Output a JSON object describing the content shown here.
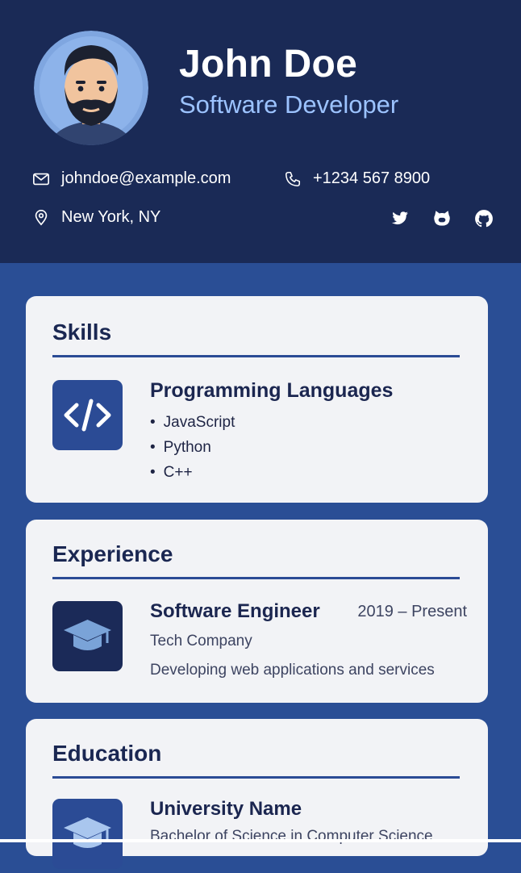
{
  "profile": {
    "name": "John Doe",
    "title": "Software Developer",
    "email": "johndoe@example.com",
    "phone": "+1234 567 8900",
    "location": "New York, NY",
    "social_icons": [
      "twitter-icon",
      "github-cat-icon",
      "github-icon"
    ]
  },
  "skills": {
    "heading": "Skills",
    "icon": "code-icon",
    "group_title": "Programming Languages",
    "items": [
      "JavaScript",
      "Python",
      "C++"
    ]
  },
  "experience": {
    "heading": "Experience",
    "icon": "graduation-cap-icon",
    "role": "Software Engineer",
    "dates": "2019 – Present",
    "company": "Tech Company",
    "description": "Developing web applications and services"
  },
  "education": {
    "heading": "Education",
    "icon": "graduation-cap-icon",
    "school": "University Name",
    "degree": "Bachelor of Science in Computer Science"
  },
  "colors": {
    "header_bg": "#1a2a56",
    "page_bg": "#2a4e95",
    "card_bg": "#f2f3f6",
    "accent": "#2b4b95",
    "title_blue": "#9cc3ff"
  }
}
